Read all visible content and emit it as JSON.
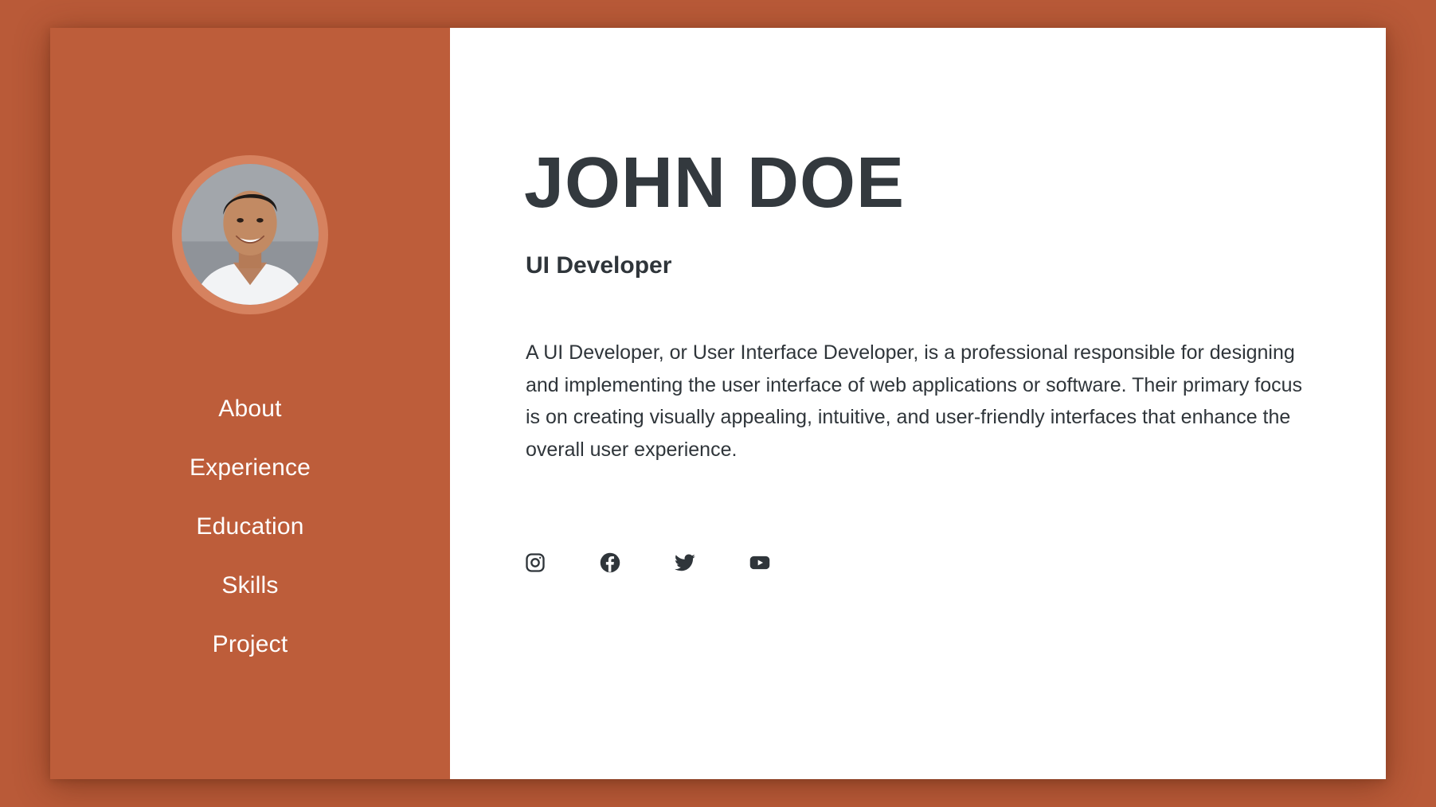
{
  "profile": {
    "name": "JOHN DOE",
    "role": "UI Developer",
    "bio": "A UI Developer, or User Interface Developer, is a professional responsible for designing and implementing the user interface of web applications or software. Their primary focus is on creating visually appealing, intuitive, and user-friendly interfaces that enhance the overall user experience."
  },
  "sidebar": {
    "nav": [
      {
        "label": "About"
      },
      {
        "label": "Experience"
      },
      {
        "label": "Education"
      },
      {
        "label": "Skills"
      },
      {
        "label": "Project"
      }
    ]
  },
  "socials": [
    {
      "icon": "instagram-icon"
    },
    {
      "icon": "facebook-icon"
    },
    {
      "icon": "twitter-icon"
    },
    {
      "icon": "youtube-icon"
    }
  ],
  "colors": {
    "background": "#b95a38",
    "sidebar": "#bd5d3a",
    "avatar_ring": "#d6825f",
    "text_dark": "#2f353a",
    "nav_text": "#ffffff"
  }
}
